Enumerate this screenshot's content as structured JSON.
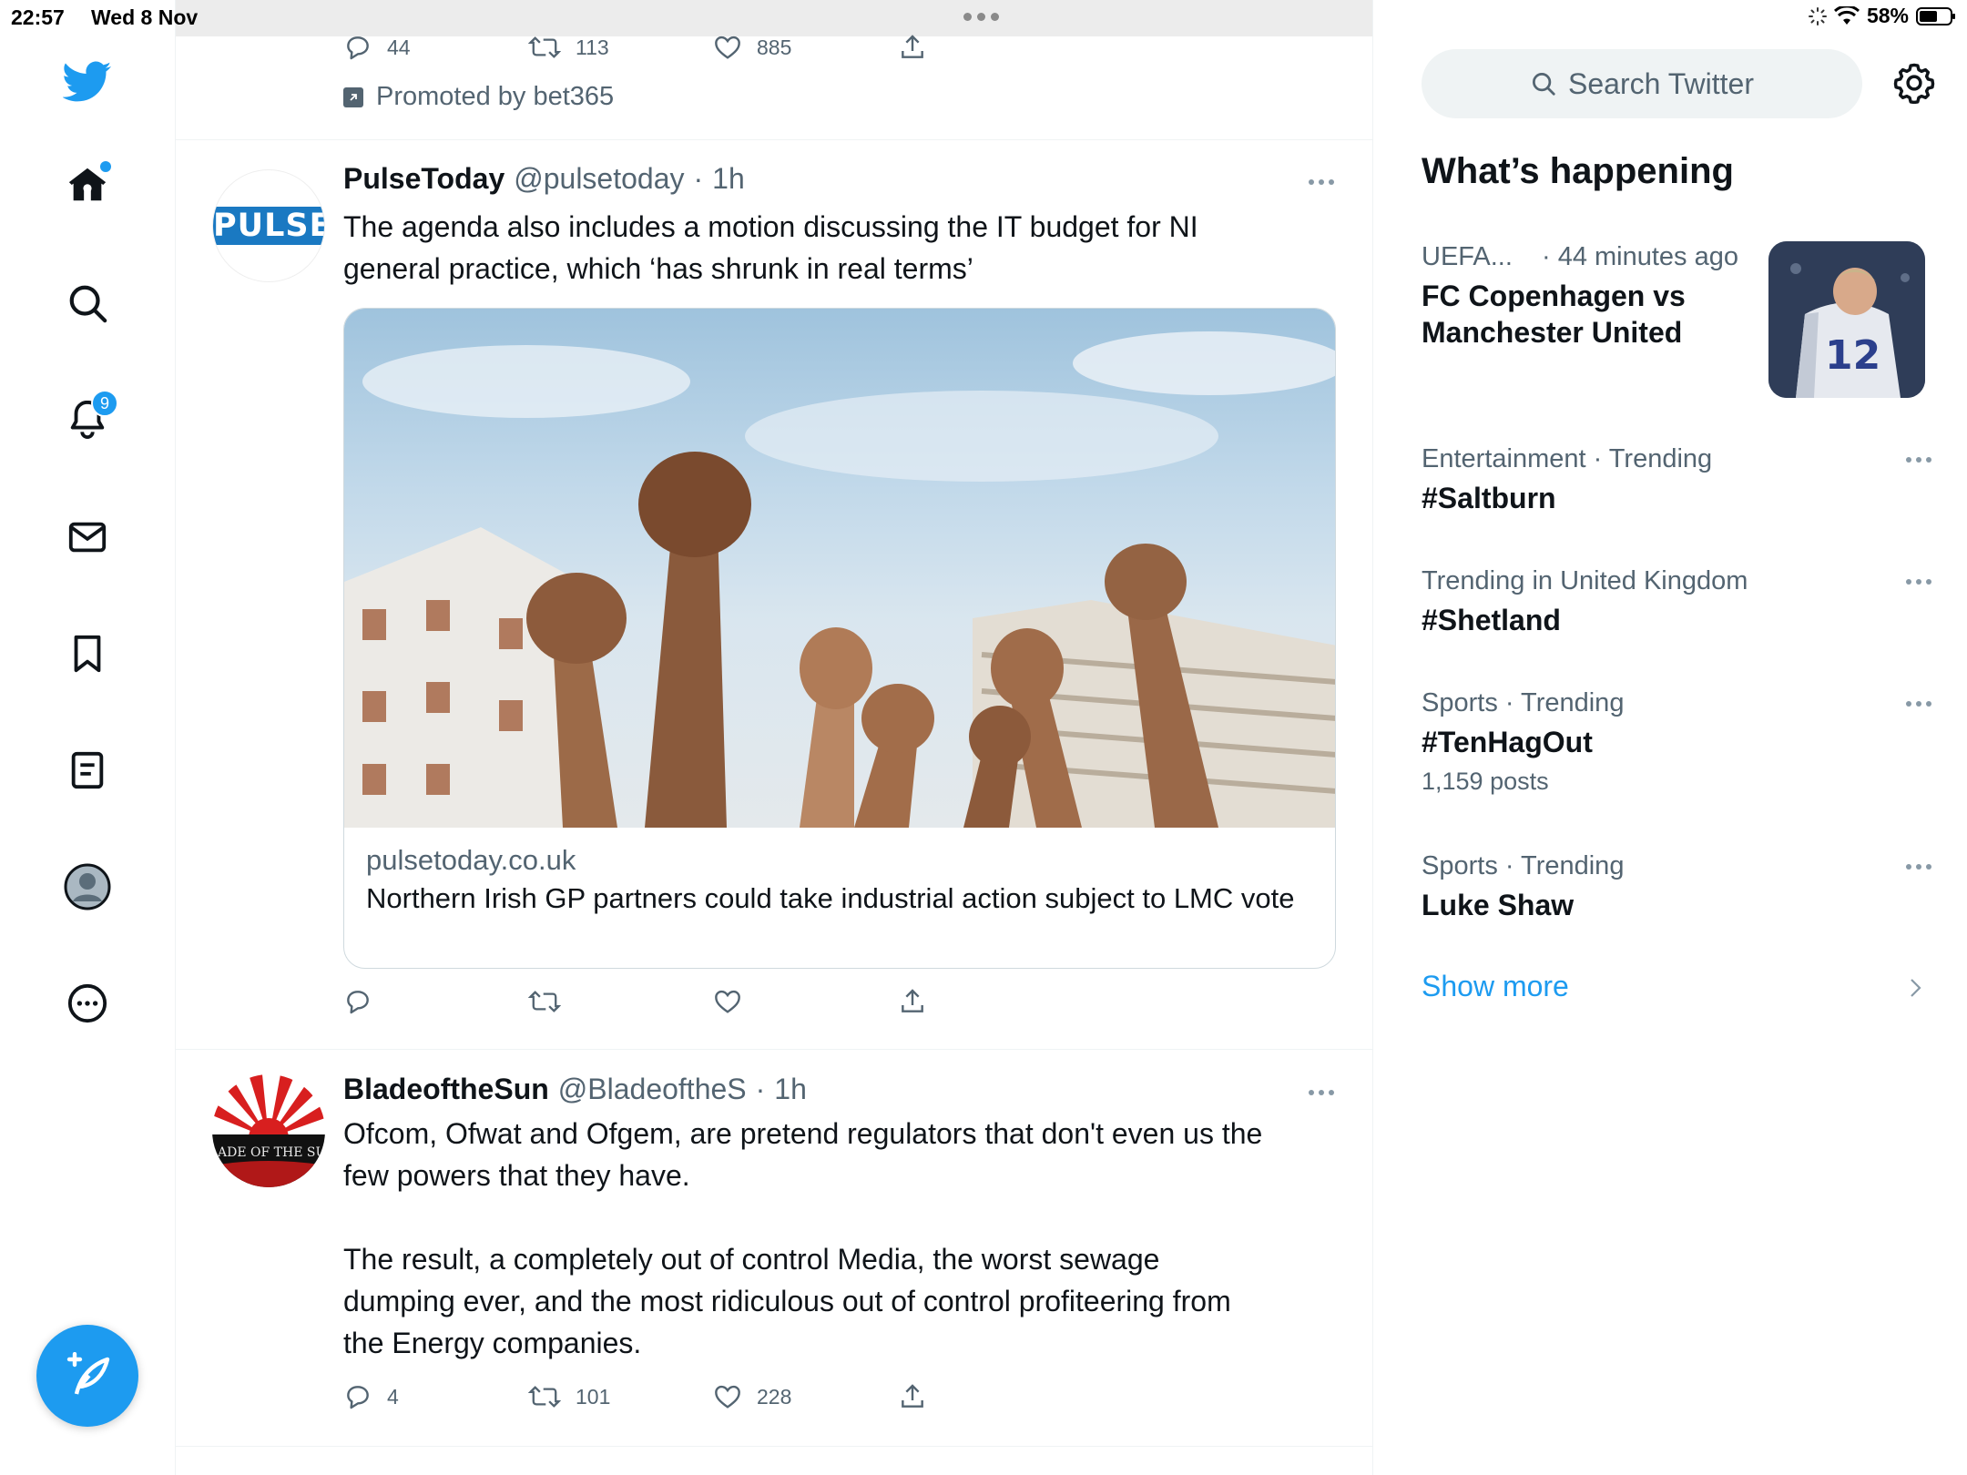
{
  "status_bar": {
    "time": "22:57",
    "date": "Wed 8 Nov",
    "battery": "58%"
  },
  "nav": {
    "notifications_badge": "9",
    "icons": [
      "twitter-bird-icon",
      "home-icon",
      "search-icon",
      "bell-icon",
      "mail-icon",
      "bookmark-icon",
      "lists-icon",
      "profile-icon",
      "more-icon",
      "compose-icon"
    ]
  },
  "promo_tweet": {
    "replies": "44",
    "retweets": "113",
    "likes": "885",
    "promoted_label": "Promoted by bet365"
  },
  "tweets": [
    {
      "avatar_text": "PULSE",
      "name": "PulseToday",
      "handle": "@pulsetoday",
      "separator": "·",
      "time": "1h",
      "text_lines": [
        "The agenda also includes a motion discussing the IT budget for NI",
        "general practice, which ‘has shrunk in real terms’"
      ],
      "card": {
        "domain": "pulsetoday.co.uk",
        "title": "Northern Irish GP partners could take industrial action subject to LMC vote"
      },
      "replies": "",
      "retweets": "",
      "likes": ""
    },
    {
      "avatar_text": "BLADE OF THE SUN",
      "name": "BladeoftheSun",
      "handle": "@BladeoftheS",
      "separator": "·",
      "time": "1h",
      "text_lines": [
        "Ofcom, Ofwat and Ofgem, are pretend regulators that don't even us the",
        "few powers that they have.",
        "",
        "The result, a completely out of control Media, the worst sewage",
        "dumping ever, and the most ridiculous out of control profiteering from",
        "the Energy companies."
      ],
      "replies": "4",
      "retweets": "101",
      "likes": "228"
    }
  ],
  "sidebar": {
    "search_placeholder": "Search Twitter",
    "title": "What’s happening",
    "trends": [
      {
        "meta": "UEFA...",
        "meta_time": "· 44 minutes ago",
        "name": "FC Copenhagen vs Manchester United",
        "count": ""
      },
      {
        "meta": "Entertainment · Trending",
        "name": "#Saltburn",
        "count": ""
      },
      {
        "meta": "Trending in United Kingdom",
        "name": "#Shetland",
        "count": ""
      },
      {
        "meta": "Sports · Trending",
        "name": "#TenHagOut",
        "count": "1,159 posts"
      },
      {
        "meta": "Sports · Trending",
        "name": "Luke Shaw",
        "count": ""
      }
    ],
    "thumb_jersey_number": "12",
    "show_more": "Show more"
  },
  "colors": {
    "accent": "#1d9bf0",
    "text_primary": "#0f1419",
    "text_secondary": "#536471",
    "border": "#eff3f4"
  }
}
